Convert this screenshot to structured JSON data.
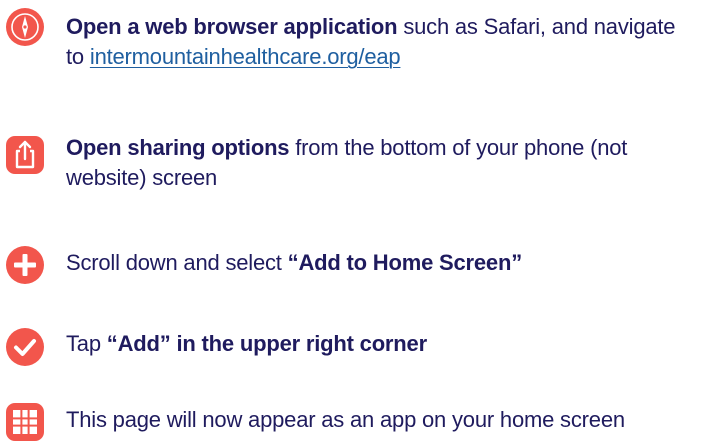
{
  "colors": {
    "accent": "#f2564c",
    "text": "#1f1b5e",
    "link": "#1f5fa0"
  },
  "steps": [
    {
      "icon": "compass-icon",
      "bold": "Open a web browser application",
      "rest": " such as Safari, and navigate to ",
      "link": "intermountainhealthcare.org/eap"
    },
    {
      "icon": "share-icon",
      "bold": "Open sharing options",
      "rest": " from the bottom of your phone (not website) screen"
    },
    {
      "icon": "plus-icon",
      "rest": "Scroll down and select ",
      "bold": "“Add to Home Screen”"
    },
    {
      "icon": "checkmark-icon",
      "rest": "Tap ",
      "bold": "“Add” in the upper right corner"
    },
    {
      "icon": "app-grid-icon",
      "rest": "This page will now appear as an app on your home screen"
    }
  ]
}
